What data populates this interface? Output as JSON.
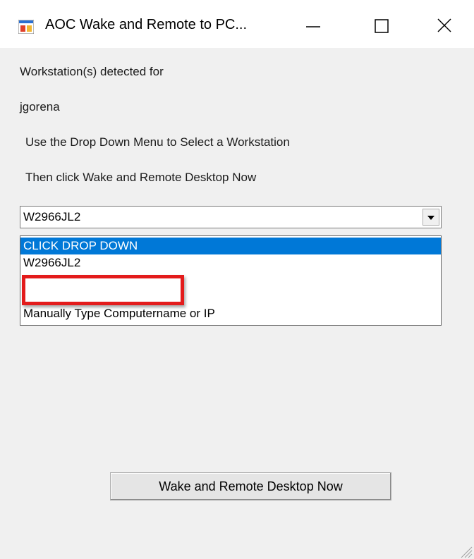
{
  "window": {
    "title": "AOC Wake and Remote to PC...",
    "background": "#f0f0f0"
  },
  "titlebar": {
    "minimize_icon": "minimize-icon",
    "maximize_icon": "maximize-icon",
    "close_icon": "close-icon",
    "app_icon": "app-window-icon"
  },
  "labels": {
    "detected": "Workstation(s) detected for",
    "username": "jgorena",
    "instruction_1": "Use the Drop Down Menu to Select a Workstation",
    "instruction_2": "Then click Wake and Remote Desktop Now"
  },
  "combo": {
    "value": "W2966JL2",
    "arrow_icon": "dropdown-arrow-icon",
    "options": [
      {
        "label": "CLICK DROP DOWN",
        "selected": true
      },
      {
        "label": "W2966JL2",
        "selected": false
      },
      {
        "label": "",
        "selected": false
      },
      {
        "label": "",
        "selected": false
      },
      {
        "label": "Manually Type Computername or IP",
        "selected": false
      }
    ]
  },
  "action_button": {
    "label": "Wake and Remote Desktop Now"
  },
  "colors": {
    "selection": "#0078d7",
    "highlight_border": "#e31b1b"
  }
}
